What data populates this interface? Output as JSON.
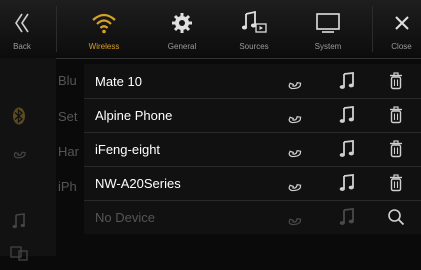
{
  "topbar": {
    "back_label": "Back",
    "wireless_label": "Wireless",
    "general_label": "General",
    "sources_label": "Sources",
    "system_label": "System",
    "close_label": "Close"
  },
  "background_list": {
    "items": [
      "Blu",
      "Set",
      "Har",
      "iPh"
    ]
  },
  "devices": [
    {
      "name": "Mate 10"
    },
    {
      "name": "Alpine Phone"
    },
    {
      "name": "iFeng-eight"
    },
    {
      "name": "NW-A20Series"
    },
    {
      "name": "No Device"
    }
  ],
  "colors": {
    "accent": "#d9a126",
    "background": "#0a0a0a",
    "dim_text": "#555555"
  },
  "icons": {
    "back": "double-chevron-left-icon",
    "wireless": "wifi-icon",
    "general": "gear-icon",
    "sources": "music-note-icon",
    "system": "monitor-icon",
    "close": "close-icon",
    "row_phone": "phone-icon",
    "row_music": "music-note-icon",
    "row_delete": "trash-icon",
    "row_search": "search-icon"
  }
}
